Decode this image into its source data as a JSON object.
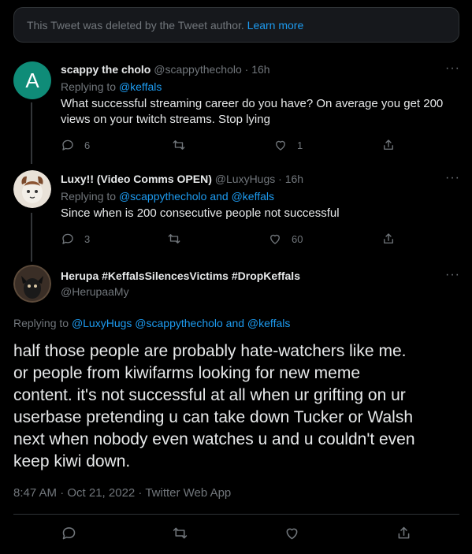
{
  "deleted_notice": {
    "text": "This Tweet was deleted by the Tweet author.",
    "link": "Learn more"
  },
  "tweets": [
    {
      "avatar_letter": "A",
      "avatar_color": "#0f8c78",
      "name": "scappy the cholo",
      "handle": "@scappythecholo · 16h",
      "replying_prefix": "Replying to",
      "replying_to": "@keffals",
      "text_lines": [
        "What successful streaming career do you have? On average you get 200",
        "views on your twitch streams. Stop lying"
      ],
      "replies": "6",
      "retweets": "",
      "likes": "1"
    },
    {
      "name": "Luxy!! (Video Comms OPEN)",
      "handle": "@LuxyHugs · 16h",
      "replying_prefix": "Replying to",
      "replying_to": "@scappythecholo and @keffals",
      "text_lines": [
        "Since when is 200 consecutive people not successful"
      ],
      "replies": "3",
      "retweets": "",
      "likes": "60"
    }
  ],
  "main_tweet": {
    "name": "Herupa #KeffalsSilencesVictims #DropKeffals",
    "handle": "@HerupaaMy",
    "replying_prefix": "Replying to",
    "replying_to": "@LuxyHugs @scappythecholo and @keffals",
    "text_lines": [
      "half those people are probably hate-watchers like me.",
      "or people from kiwifarms looking for new meme",
      "content. it's not successful at all when ur grifting on ur",
      "userbase pretending u can take down Tucker or Walsh",
      "next when nobody even watches u and u couldn't even",
      "keep kiwi down."
    ],
    "timestamp": "8:47 AM · Oct 21, 2022 · Twitter Web App"
  },
  "icons": {
    "reply": "reply-icon",
    "retweet": "retweet-icon",
    "like": "heart-icon",
    "share": "share-icon",
    "more": "more-icon"
  },
  "colors": {
    "accent": "#1d9bf0",
    "muted": "#71767b",
    "text": "#e7e9ea",
    "background": "#000000"
  }
}
